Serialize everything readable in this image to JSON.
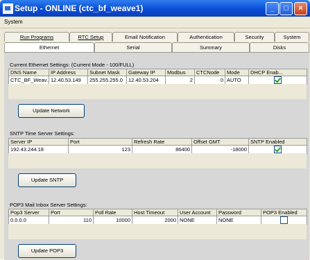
{
  "window": {
    "title": "Setup - ONLINE (ctc_bf_weave1)",
    "controls": {
      "minimize": "_",
      "maximize": "□",
      "close": "×"
    }
  },
  "menu": {
    "items": [
      "System"
    ]
  },
  "tabs": {
    "row1": [
      "Run Programs",
      "RTC Setup",
      "Email Notification",
      "Authentication",
      "Security",
      "System"
    ],
    "row2": [
      "Ethernet",
      "Serial",
      "Summary",
      "Disks"
    ],
    "active": "Ethernet"
  },
  "ethernet": {
    "title": "Current Ethernet Settings: (Current Mode - 100/FULL)",
    "columns": [
      "DNS Name",
      "IP Address",
      "Subnet Mask",
      "Gateway IP",
      "Modbus",
      "CTCNode",
      "Mode",
      "DHCP Enab..."
    ],
    "row": {
      "dns": "CTC_BF_Weav...",
      "ip": "12.40.53.149",
      "mask": "255.255.255.0",
      "gateway": "12.40.53.204",
      "modbus": "2",
      "ctcnode": "0",
      "mode": "AUTO",
      "dhcp": true
    },
    "button": "Update Network"
  },
  "sntp": {
    "title": "SNTP Time Server Settings:",
    "columns": [
      "Server IP",
      "Port",
      "Refresh Rate",
      "Offset GMT",
      "SNTP Enabled"
    ],
    "row": {
      "server": "192.43.244.18",
      "port": "123",
      "refresh": "86400",
      "offset": "-18000",
      "enabled": true
    },
    "button": "Update SNTP"
  },
  "pop3": {
    "title": "POP3 Mail Inbox Server Settings:",
    "columns": [
      "Pop3 Server",
      "Port",
      "Poll Rate",
      "Host Timeout",
      "User Account",
      "Password",
      "POP3 Enabled"
    ],
    "row": {
      "server": "0.0.0.0",
      "port": "110",
      "poll": "10000",
      "timeout": "2000",
      "user": "NONE",
      "password": "NONE",
      "enabled": false
    },
    "button": "Update POP3"
  }
}
